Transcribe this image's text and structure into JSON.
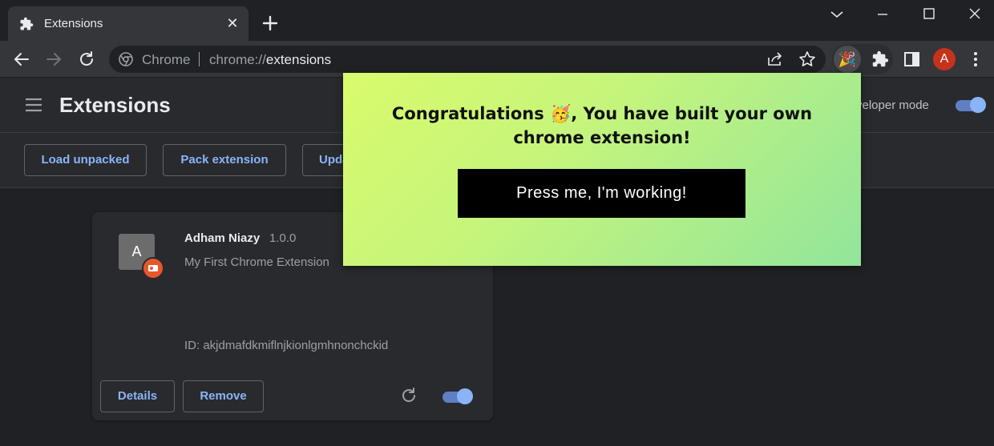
{
  "tab": {
    "title": "Extensions",
    "close": "✕",
    "icon": "puzzle-icon"
  },
  "omnibox": {
    "site_label": "Chrome",
    "url_scheme": "chrome://",
    "url_host": "extensions"
  },
  "profile": {
    "initial": "A",
    "color": "#c5331b"
  },
  "header": {
    "title": "Extensions",
    "dev_mode_label": "veloper mode",
    "dev_mode_on": true
  },
  "actions": {
    "load_unpacked": "Load unpacked",
    "pack_extension": "Pack extension",
    "update": "Update"
  },
  "extension": {
    "icon_letter": "A",
    "name": "Adham Niazy",
    "version": "1.0.0",
    "description": "My First Chrome Extension",
    "id_text": "ID: akjdmafdkmiflnjkionlgmhnonchckid",
    "details_label": "Details",
    "remove_label": "Remove",
    "enabled": true
  },
  "popup": {
    "message": "Congratulations 🥳, You have built your own chrome extension!",
    "button_label": "Press me, I'm working!"
  },
  "colors": {
    "accent": "#8ab4f8",
    "popup_gradient_start": "#d9fa6c",
    "popup_gradient_end": "#92e59c"
  }
}
